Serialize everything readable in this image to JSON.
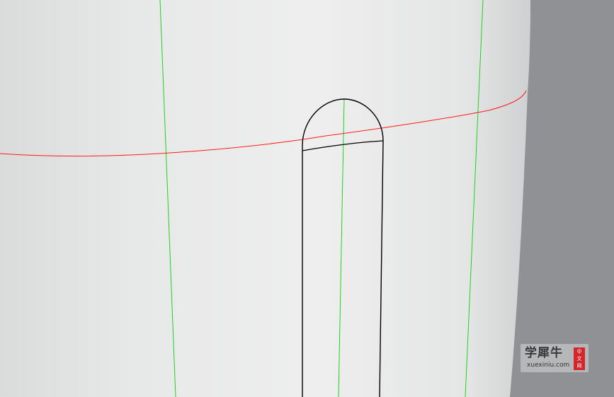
{
  "viewport": {
    "background_color": "#8f9194",
    "model_color": "#e6e7e7",
    "green_isocurve_color": "#1fd21f",
    "red_curve_color": "#ff1a1a",
    "outline_color": "#000000"
  },
  "watermark": {
    "title": "学犀牛",
    "url": "xuexiniu.com",
    "badge_chars": [
      "中",
      "文",
      "网"
    ],
    "badge_color": "#d4262b"
  }
}
